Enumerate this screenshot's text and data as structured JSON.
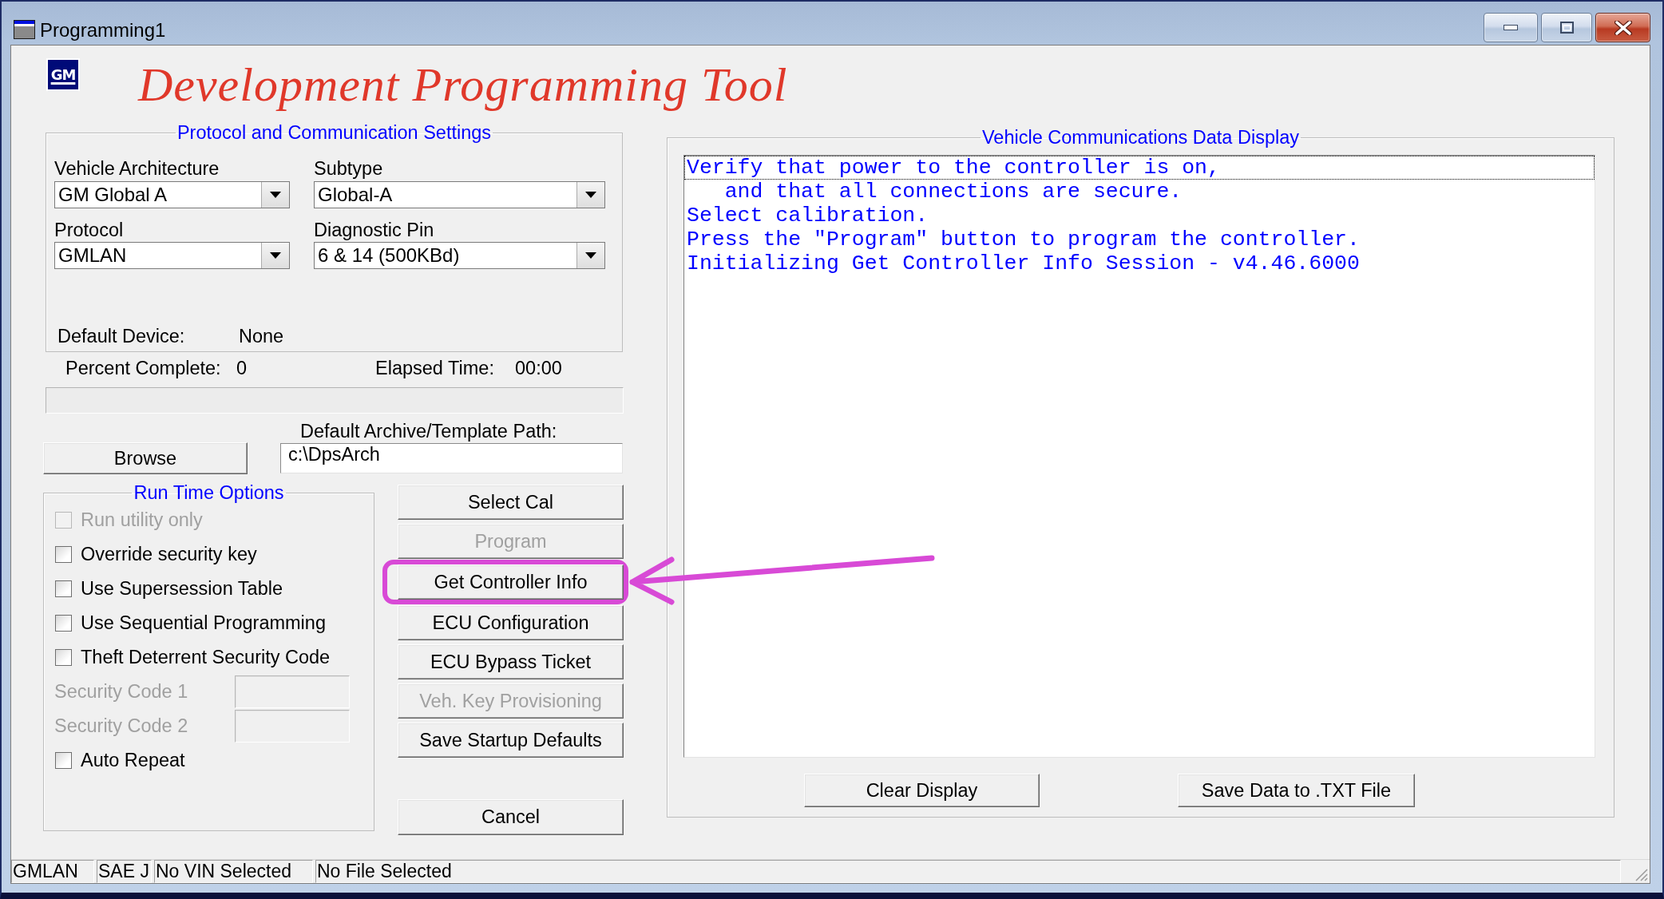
{
  "window": {
    "title": "Programming1"
  },
  "logo": {
    "text": "GM"
  },
  "app_title": "Development Programming Tool",
  "protocol_settings": {
    "title": "Protocol and Communication Settings",
    "fields": [
      {
        "label": "Vehicle Architecture",
        "value": "GM Global A"
      },
      {
        "label": "Subtype",
        "value": "Global-A"
      },
      {
        "label": "Protocol",
        "value": "GMLAN"
      },
      {
        "label": "Diagnostic Pin",
        "value": "6 & 14 (500KBd)"
      }
    ],
    "default_device": {
      "label": "Default Device:",
      "value": "None"
    }
  },
  "progress": {
    "percent_label": "Percent Complete:",
    "percent_value": "0",
    "elapsed_label": "Elapsed Time:",
    "elapsed_value": "00:00",
    "level": 0
  },
  "archive": {
    "label": "Default Archive/Template Path:",
    "value": "c:\\DpsArch",
    "browse_button": "Browse"
  },
  "run_time_options": {
    "title": "Run Time Options",
    "items": [
      {
        "kind": "checkbox",
        "label": "Run utility only",
        "checked": false,
        "disabled": true
      },
      {
        "kind": "checkbox",
        "label": "Override security key",
        "checked": false,
        "disabled": false
      },
      {
        "kind": "checkbox",
        "label": "Use Supersession Table",
        "checked": false,
        "disabled": false
      },
      {
        "kind": "checkbox",
        "label": "Use Sequential Programming",
        "checked": false,
        "disabled": false
      },
      {
        "kind": "checkbox",
        "label": "Theft Deterrent Security Code",
        "checked": false,
        "disabled": false
      },
      {
        "kind": "field",
        "label": "Security Code 1",
        "disabled": true
      },
      {
        "kind": "field",
        "label": "Security Code 2",
        "disabled": true
      },
      {
        "kind": "checkbox",
        "label": "Auto Repeat",
        "checked": false,
        "disabled": false
      }
    ]
  },
  "actions": [
    {
      "label": "Select Cal",
      "disabled": false,
      "highlighted": false
    },
    {
      "label": "Program",
      "disabled": true,
      "highlighted": false
    },
    {
      "label": "Get Controller Info",
      "disabled": false,
      "highlighted": true
    },
    {
      "label": "ECU Configuration",
      "disabled": false,
      "highlighted": false
    },
    {
      "label": "ECU Bypass Ticket",
      "disabled": false,
      "highlighted": false
    },
    {
      "label": "Veh. Key Provisioning",
      "disabled": true,
      "highlighted": false
    },
    {
      "label": "Save Startup Defaults",
      "disabled": false,
      "highlighted": false
    }
  ],
  "cancel_button": "Cancel",
  "data_display": {
    "title": "Vehicle Communications Data Display",
    "lines": [
      {
        "text": "Verify that power to the controller is on,",
        "focused": true
      },
      {
        "text": "   and that all connections are secure.",
        "focused": false
      },
      {
        "text": "Select calibration.",
        "focused": false
      },
      {
        "text": "Press the \"Program\" button to program the controller.",
        "focused": false
      },
      {
        "text": "Initializing Get Controller Info Session - v4.46.6000",
        "focused": false
      }
    ],
    "buttons": [
      "Clear Display",
      "Save Data to .TXT File"
    ]
  },
  "status_bar": [
    "GMLAN",
    "SAE J",
    "No VIN Selected",
    "No File Selected"
  ]
}
